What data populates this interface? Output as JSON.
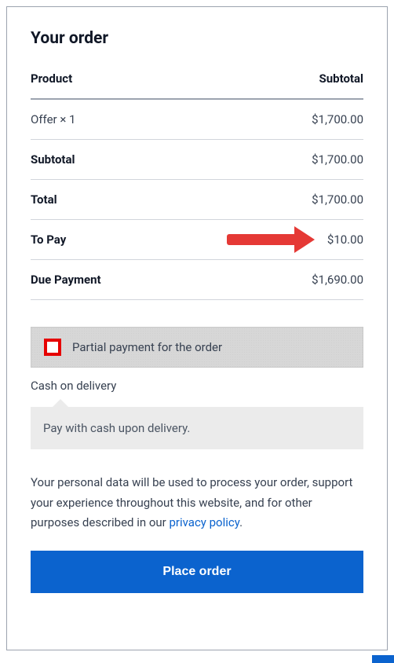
{
  "heading": "Your order",
  "table": {
    "header": {
      "product": "Product",
      "subtotal": "Subtotal"
    },
    "rows": [
      {
        "label": "Offer × 1",
        "value": "$1,700.00",
        "plain": true
      },
      {
        "label": "Subtotal",
        "value": "$1,700.00"
      },
      {
        "label": "Total",
        "value": "$1,700.00"
      },
      {
        "label": "To Pay",
        "value": "$10.00",
        "arrow": true
      },
      {
        "label": "Due Payment",
        "value": "$1,690.00"
      }
    ]
  },
  "payment_method": {
    "label": "Partial payment for the order",
    "submethod_label": "Cash on delivery",
    "submethod_desc": "Pay with cash upon delivery."
  },
  "privacy": {
    "text_before": "Your personal data will be used to process your order, support your experience throughout this website, and for other purposes described in our ",
    "link_text": "privacy policy",
    "text_after": "."
  },
  "button": {
    "place_order": "Place order"
  }
}
